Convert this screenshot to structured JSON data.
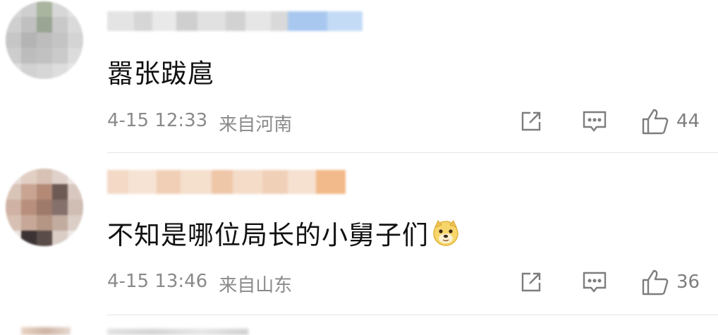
{
  "comments": [
    {
      "text": "嚣张跋扈",
      "date": "4-15 12:33",
      "location": "来自河南",
      "likes": "44",
      "has_emoji": false
    },
    {
      "text": "不知是哪位局长的小舅子们",
      "date": "4-15 13:46",
      "location": "来自山东",
      "likes": "36",
      "has_emoji": true,
      "emoji_icon": "doge-emoji-icon"
    }
  ],
  "icons": {
    "share": "share-icon",
    "comment": "comment-icon",
    "like": "thumbs-up-icon"
  },
  "colors": {
    "text": "#111111",
    "meta": "#8a8a8a",
    "icon": "#7d7d7d",
    "divider": "#e6e6e6",
    "username_blur_accent": "#a9c8ef",
    "username_blur_warm": "#f2b98a"
  }
}
